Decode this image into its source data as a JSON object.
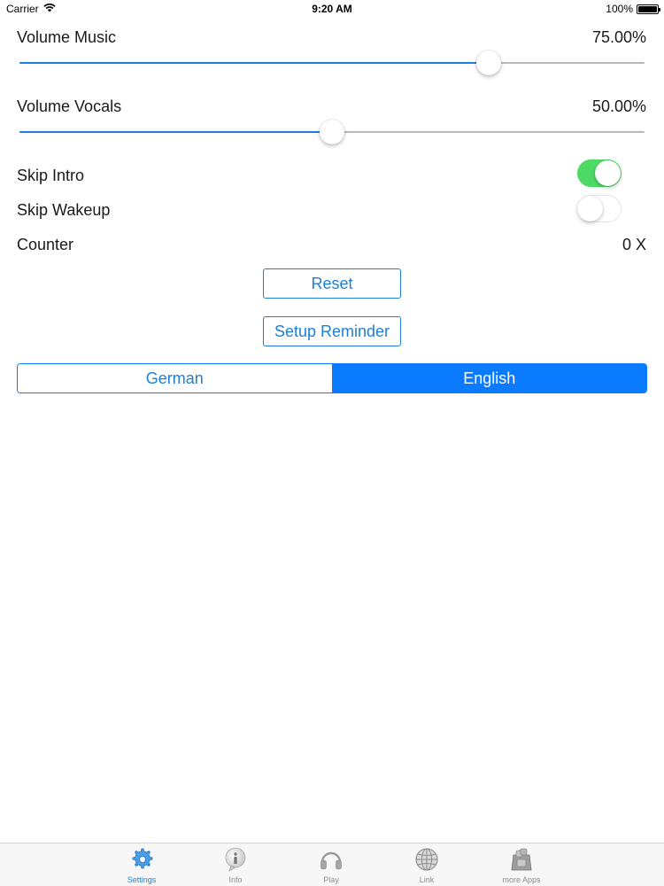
{
  "status_bar": {
    "carrier": "Carrier",
    "time": "9:20 AM",
    "battery": "100%",
    "battery_level": 1.0
  },
  "settings": {
    "volume_music": {
      "label": "Volume Music",
      "value_text": "75.00%",
      "level": 0.75
    },
    "volume_vocals": {
      "label": "Volume Vocals",
      "value_text": "50.00%",
      "level": 0.5
    },
    "skip_intro": {
      "label": "Skip Intro",
      "enabled": true
    },
    "skip_wakeup": {
      "label": "Skip Wakeup",
      "enabled": false
    },
    "counter": {
      "label": "Counter",
      "value": "0 X"
    }
  },
  "buttons": {
    "reset": "Reset",
    "setup_reminder": "Setup Reminder"
  },
  "language": {
    "options": [
      "German",
      "English"
    ],
    "selected": "English"
  },
  "tab_bar": {
    "tabs": [
      {
        "label": "Settings",
        "icon": "gear-icon",
        "selected": true
      },
      {
        "label": "Info",
        "icon": "info-icon",
        "selected": false
      },
      {
        "label": "Play",
        "icon": "headphones-icon",
        "selected": false
      },
      {
        "label": "Link",
        "icon": "globe-icon",
        "selected": false
      },
      {
        "label": "more Apps",
        "icon": "app-store-icon",
        "selected": false
      }
    ]
  },
  "colors": {
    "accent": "#1f7fd6",
    "segment_active": "#0a7aff",
    "toggle_on": "#4cd964",
    "tab_inactive": "#8e8e8e"
  }
}
